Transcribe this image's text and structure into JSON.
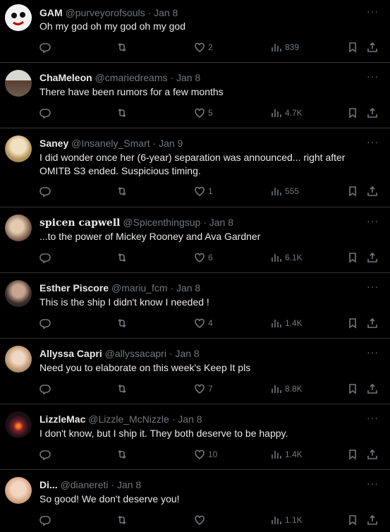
{
  "tweets": [
    {
      "name": "GAM",
      "handle": "@purveyorofsouls",
      "date": "Jan 8",
      "text": "Oh my god oh my god oh my god",
      "likes": "2",
      "views": "839",
      "avatar": "#f2f2f2"
    },
    {
      "name": "ChaMeleon",
      "handle": "@cmariedreams",
      "date": "Jan 8",
      "text": "There have been rumors for a few months",
      "likes": "5",
      "views": "4.7K",
      "avatar": "#6f6258"
    },
    {
      "name": "Saney",
      "handle": "@Insanely_Smart",
      "date": "Jan 9",
      "text": "I did wonder once her (6-year) separation was announced... right after OMITB S3 ended. Suspicious timing.",
      "likes": "1",
      "views": "555",
      "avatar": "#cdb58a"
    },
    {
      "name": "spicen capwell",
      "handle": "@Spicenthingsup",
      "date": "Jan 8",
      "text": "...to the power of Mickey Rooney and Ava Gardner",
      "likes": "6",
      "views": "6.1K",
      "avatar": "#a8907a"
    },
    {
      "name": "Esther Piscore",
      "handle": "@mariu_fcm",
      "date": "Jan 8",
      "text": "This is the ship I didn't know I needed !",
      "likes": "4",
      "views": "1.4K",
      "avatar": "#3b3a3a"
    },
    {
      "name": "Allyssa Capri",
      "handle": "@allyssacapri",
      "date": "Jan 8",
      "text": "Need you to elaborate on this week's Keep It pls",
      "likes": "7",
      "views": "8.8K",
      "avatar": "#c9a27a"
    },
    {
      "name": "LizzleMac",
      "handle": "@Lizzle_McNizzle",
      "date": "Jan 8",
      "text": "I don't know, but I ship it. They both deserve to be happy.",
      "likes": "10",
      "views": "1.4K",
      "avatar": "#1a1016"
    },
    {
      "name": "Di...",
      "handle": "@dianereti",
      "date": "Jan 8",
      "text": "So good! We don't deserve you!",
      "likes": "",
      "views": "1.1K",
      "avatar": "#d9b59c"
    }
  ],
  "ui": {
    "separator": "·",
    "more": "···"
  }
}
